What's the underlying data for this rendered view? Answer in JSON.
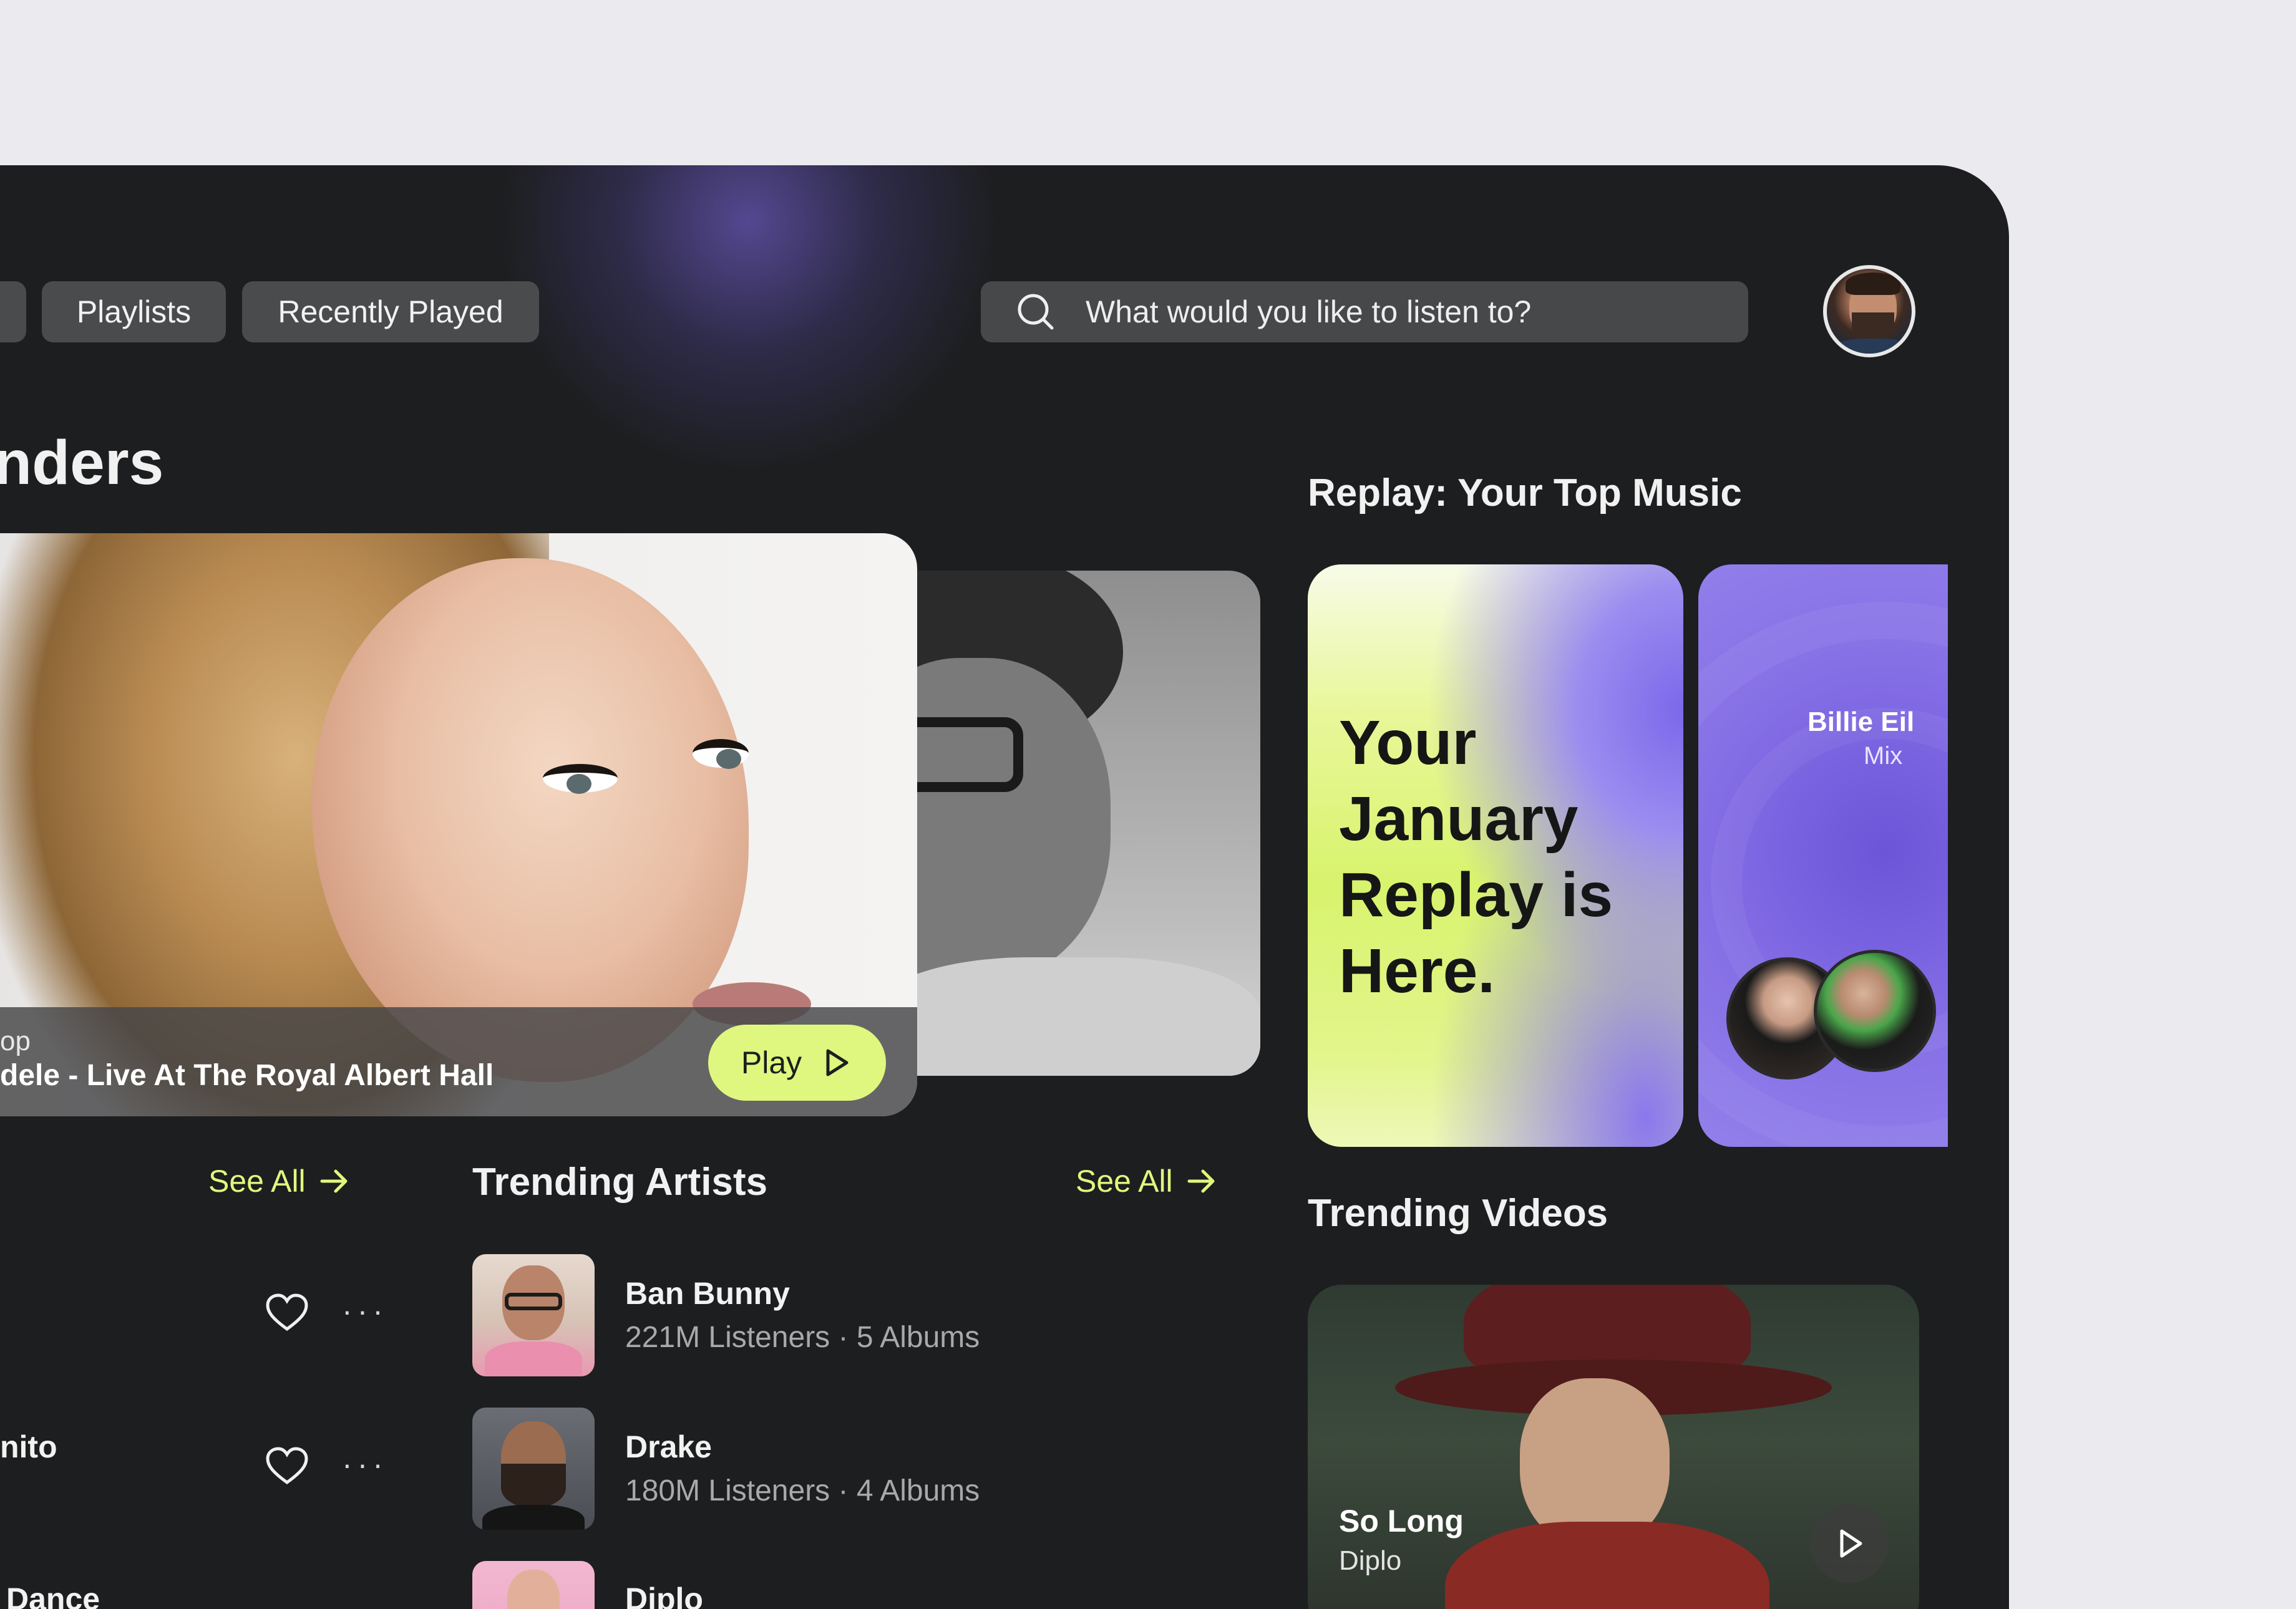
{
  "nav": {
    "tabs": [
      "Playlists",
      "Recently Played"
    ],
    "search_placeholder": "What would you like to listen to?"
  },
  "hero": {
    "section_title_fragment": "nders",
    "card": {
      "subtitle_fragment": "op",
      "title_fragment": "dele - Live At The Royal Albert Hall",
      "play_label": "Play"
    }
  },
  "replay": {
    "title": "Replay: Your Top Music",
    "card1_text": [
      "Your",
      "January",
      "Replay is",
      "Here."
    ],
    "card2_name": "Billie Eil",
    "card2_sub": "Mix"
  },
  "songs": {
    "see_all": "See All",
    "items": [
      "",
      "nito",
      "Dance"
    ]
  },
  "trending_artists": {
    "title": "Trending Artists",
    "see_all": "See All",
    "items": [
      {
        "name": "Ban Bunny",
        "meta": "221M Listeners · 5 Albums"
      },
      {
        "name": "Drake",
        "meta": "180M Listeners · 4 Albums"
      },
      {
        "name": "Diplo",
        "meta": ""
      }
    ]
  },
  "trending_videos": {
    "title": "Trending Videos",
    "video": {
      "title": "So Long",
      "artist": "Diplo"
    }
  },
  "colors": {
    "accent": "#dff77e",
    "background": "#1d1e1f",
    "purple": "#7a63e0"
  }
}
